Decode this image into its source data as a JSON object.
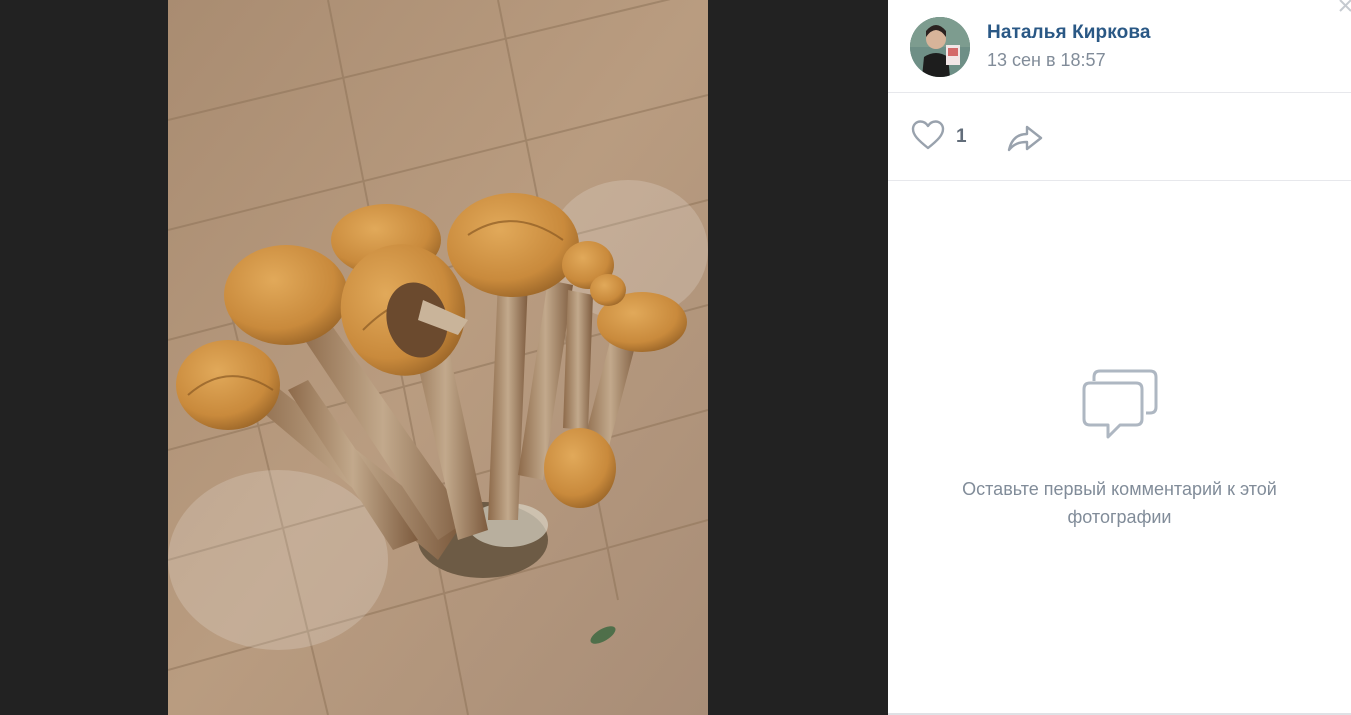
{
  "post": {
    "author_name": "Наталья Киркова",
    "date": "13 сен в 18:57"
  },
  "actions": {
    "like_count": "1"
  },
  "comments": {
    "empty_text": "Оставьте первый комментарий к этой фотографии"
  },
  "icons": {
    "like": "heart-icon",
    "share": "share-arrow-icon",
    "comments": "speech-bubbles-icon",
    "close": "close-icon"
  },
  "colors": {
    "link": "#2a5885",
    "secondary_text": "#818c99",
    "icon": "#99a2ad",
    "dark_background": "#222222"
  }
}
